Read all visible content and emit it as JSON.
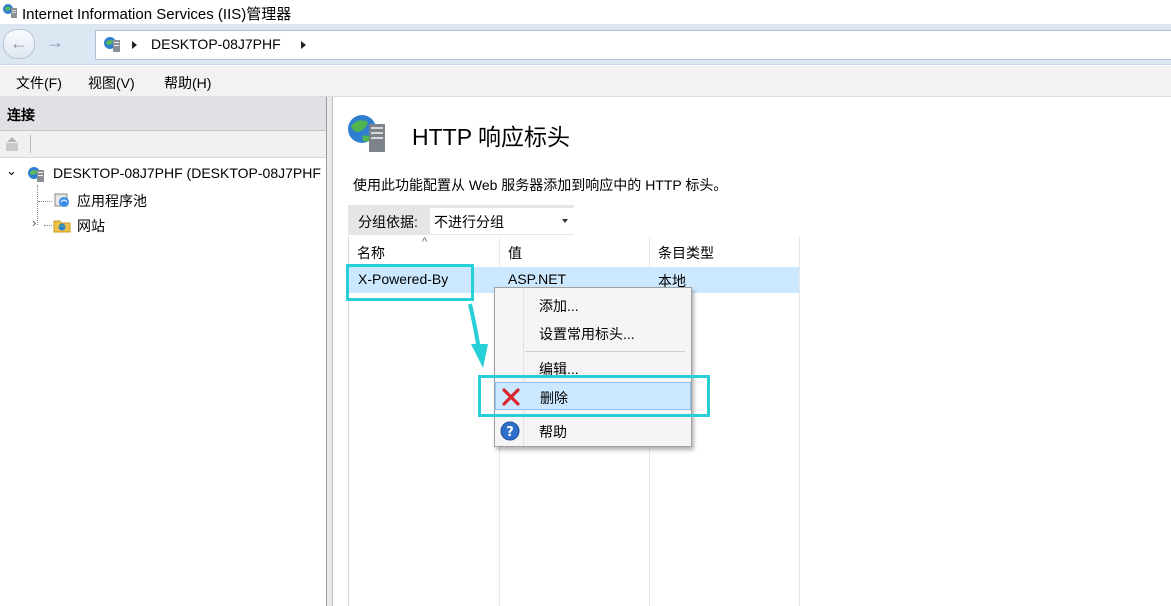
{
  "window": {
    "title": "Internet Information Services (IIS)管理器"
  },
  "address": {
    "segments": [
      "DESKTOP-08J7PHF"
    ]
  },
  "menu": {
    "items": [
      "文件(F)",
      "视图(V)",
      "帮助(H)"
    ]
  },
  "connections": {
    "header": "连接",
    "tree": {
      "server": "DESKTOP-08J7PHF (DESKTOP-08J7PHF",
      "children": [
        "应用程序池",
        "网站"
      ]
    }
  },
  "feature": {
    "title": "HTTP 响应标头",
    "description": "使用此功能配置从 Web 服务器添加到响应中的 HTTP 标头。",
    "group_label": "分组依据:",
    "group_value": "不进行分组",
    "columns": [
      "名称",
      "值",
      "条目类型"
    ],
    "rows": [
      {
        "name": "X-Powered-By",
        "value": "ASP.NET",
        "type": "本地"
      }
    ]
  },
  "context_menu": {
    "items": [
      "添加...",
      "设置常用标头...",
      "编辑...",
      "删除",
      "帮助"
    ],
    "selected": "删除"
  },
  "colors": {
    "highlight": "#27cfd6",
    "selection": "#cce8ff",
    "delete_icon": "#d9262c",
    "help_icon": "#2d6fc9"
  },
  "icons": [
    "iis-manager-icon",
    "back-arrow-icon",
    "forward-arrow-icon",
    "server-icon",
    "app-pool-icon",
    "website-folder-icon",
    "http-headers-icon",
    "delete-x-icon",
    "help-icon",
    "arrow-annotation-icon"
  ]
}
